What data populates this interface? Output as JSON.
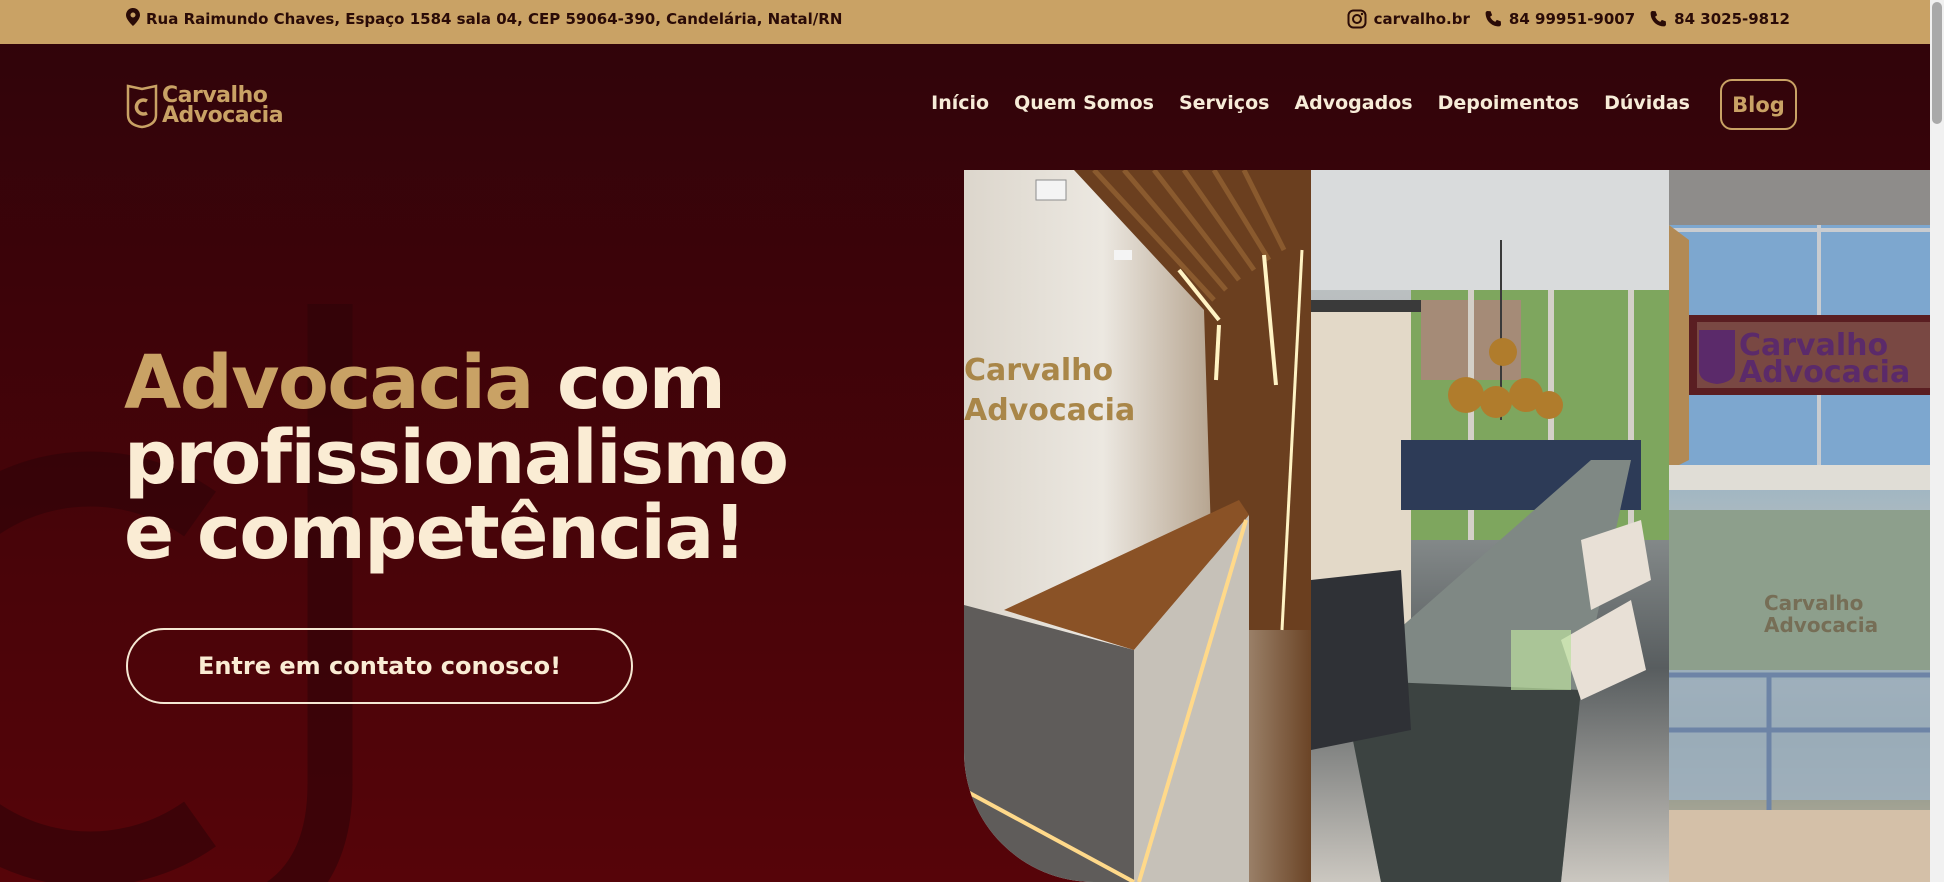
{
  "topbar": {
    "address": "Rua Raimundo Chaves, Espaço 1584 sala 04, CEP 59064-390, Candelária, Natal/RN",
    "instagram": "carvalho.br",
    "phone_1": "84 99951-9007",
    "phone_2": "84 3025-9812"
  },
  "brand": {
    "line1": "Carvalho",
    "line2": "Advocacia"
  },
  "nav": {
    "items": [
      "Início",
      "Quem Somos",
      "Serviços",
      "Advogados",
      "Depoimentos",
      "Dúvidas"
    ],
    "blog": "Blog"
  },
  "hero": {
    "headline_accent": "Advocacia",
    "headline_rest_1": " com",
    "headline_line_2": "profissionalismo",
    "headline_line_3": "e competência!",
    "cta": "Entre em contato conosco!"
  },
  "photos": [
    {
      "alt": "Recepção do escritório Carvalho Advocacia"
    },
    {
      "alt": "Sala de reuniões"
    },
    {
      "alt": "Fachada Carvalho Advocacia - Assessoria & Consultoria"
    }
  ],
  "colors": {
    "gold": "#c9a265",
    "maroon": "#3d0309",
    "cream": "#faecd4"
  }
}
